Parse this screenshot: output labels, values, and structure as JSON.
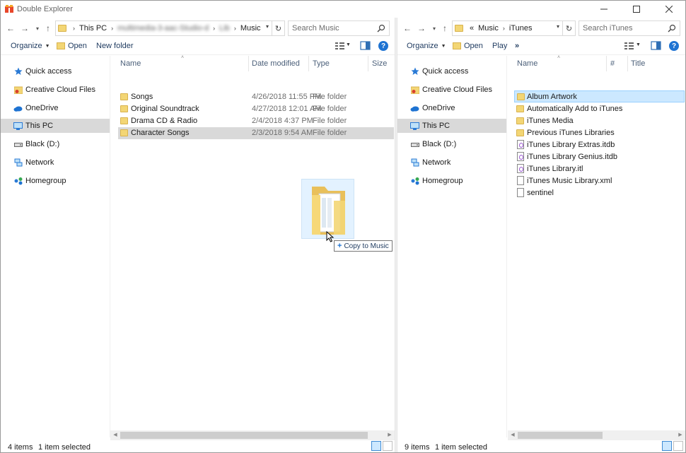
{
  "window": {
    "title": "Double Explorer"
  },
  "left": {
    "breadcrumb": [
      "This PC",
      "multimedia-3-aac-Studio-d",
      "Lib",
      "Music"
    ],
    "search_placeholder": "Search Music",
    "commands": {
      "organize": "Organize",
      "open": "Open",
      "new_folder": "New folder"
    },
    "nav": [
      "Quick access",
      "Creative Cloud Files",
      "OneDrive",
      "This PC",
      "Black (D:)",
      "Network",
      "Homegroup"
    ],
    "nav_selected": "This PC",
    "columns": {
      "name": "Name",
      "date": "Date modified",
      "type": "Type",
      "size": "Size"
    },
    "rows": [
      {
        "name": "Songs",
        "date": "4/26/2018 11:55 PM",
        "type": "File folder"
      },
      {
        "name": "Original Soundtrack",
        "date": "4/27/2018 12:01 AM",
        "type": "File folder"
      },
      {
        "name": "Drama CD & Radio",
        "date": "2/4/2018 4:37 PM",
        "type": "File folder"
      },
      {
        "name": "Character Songs",
        "date": "2/3/2018 9:54 AM",
        "type": "File folder"
      }
    ],
    "status": {
      "count": "4 items",
      "selected": "1 item selected"
    }
  },
  "right": {
    "breadcrumb_prefix": "«",
    "breadcrumb": [
      "Music",
      "iTunes"
    ],
    "search_placeholder": "Search iTunes",
    "commands": {
      "organize": "Organize",
      "open": "Open",
      "play": "Play",
      "more": "»"
    },
    "nav": [
      "Quick access",
      "Creative Cloud Files",
      "OneDrive",
      "This PC",
      "Black (D:)",
      "Network",
      "Homegroup"
    ],
    "nav_selected": "This PC",
    "columns": {
      "name": "Name",
      "num": "#",
      "title": "Title"
    },
    "rows": [
      {
        "name": "Album Artwork",
        "kind": "folder"
      },
      {
        "name": "Automatically Add to iTunes",
        "kind": "folder"
      },
      {
        "name": "iTunes Media",
        "kind": "folder"
      },
      {
        "name": "Previous iTunes Libraries",
        "kind": "folder"
      },
      {
        "name": "iTunes Library Extras.itdb",
        "kind": "itunes"
      },
      {
        "name": "iTunes Library Genius.itdb",
        "kind": "itunes"
      },
      {
        "name": "iTunes Library.itl",
        "kind": "itunes"
      },
      {
        "name": "iTunes Music Library.xml",
        "kind": "doc"
      },
      {
        "name": "sentinel",
        "kind": "doc"
      }
    ],
    "status": {
      "count": "9 items",
      "selected": "1 item selected"
    }
  },
  "drag": {
    "tooltip": "Copy to Music"
  }
}
